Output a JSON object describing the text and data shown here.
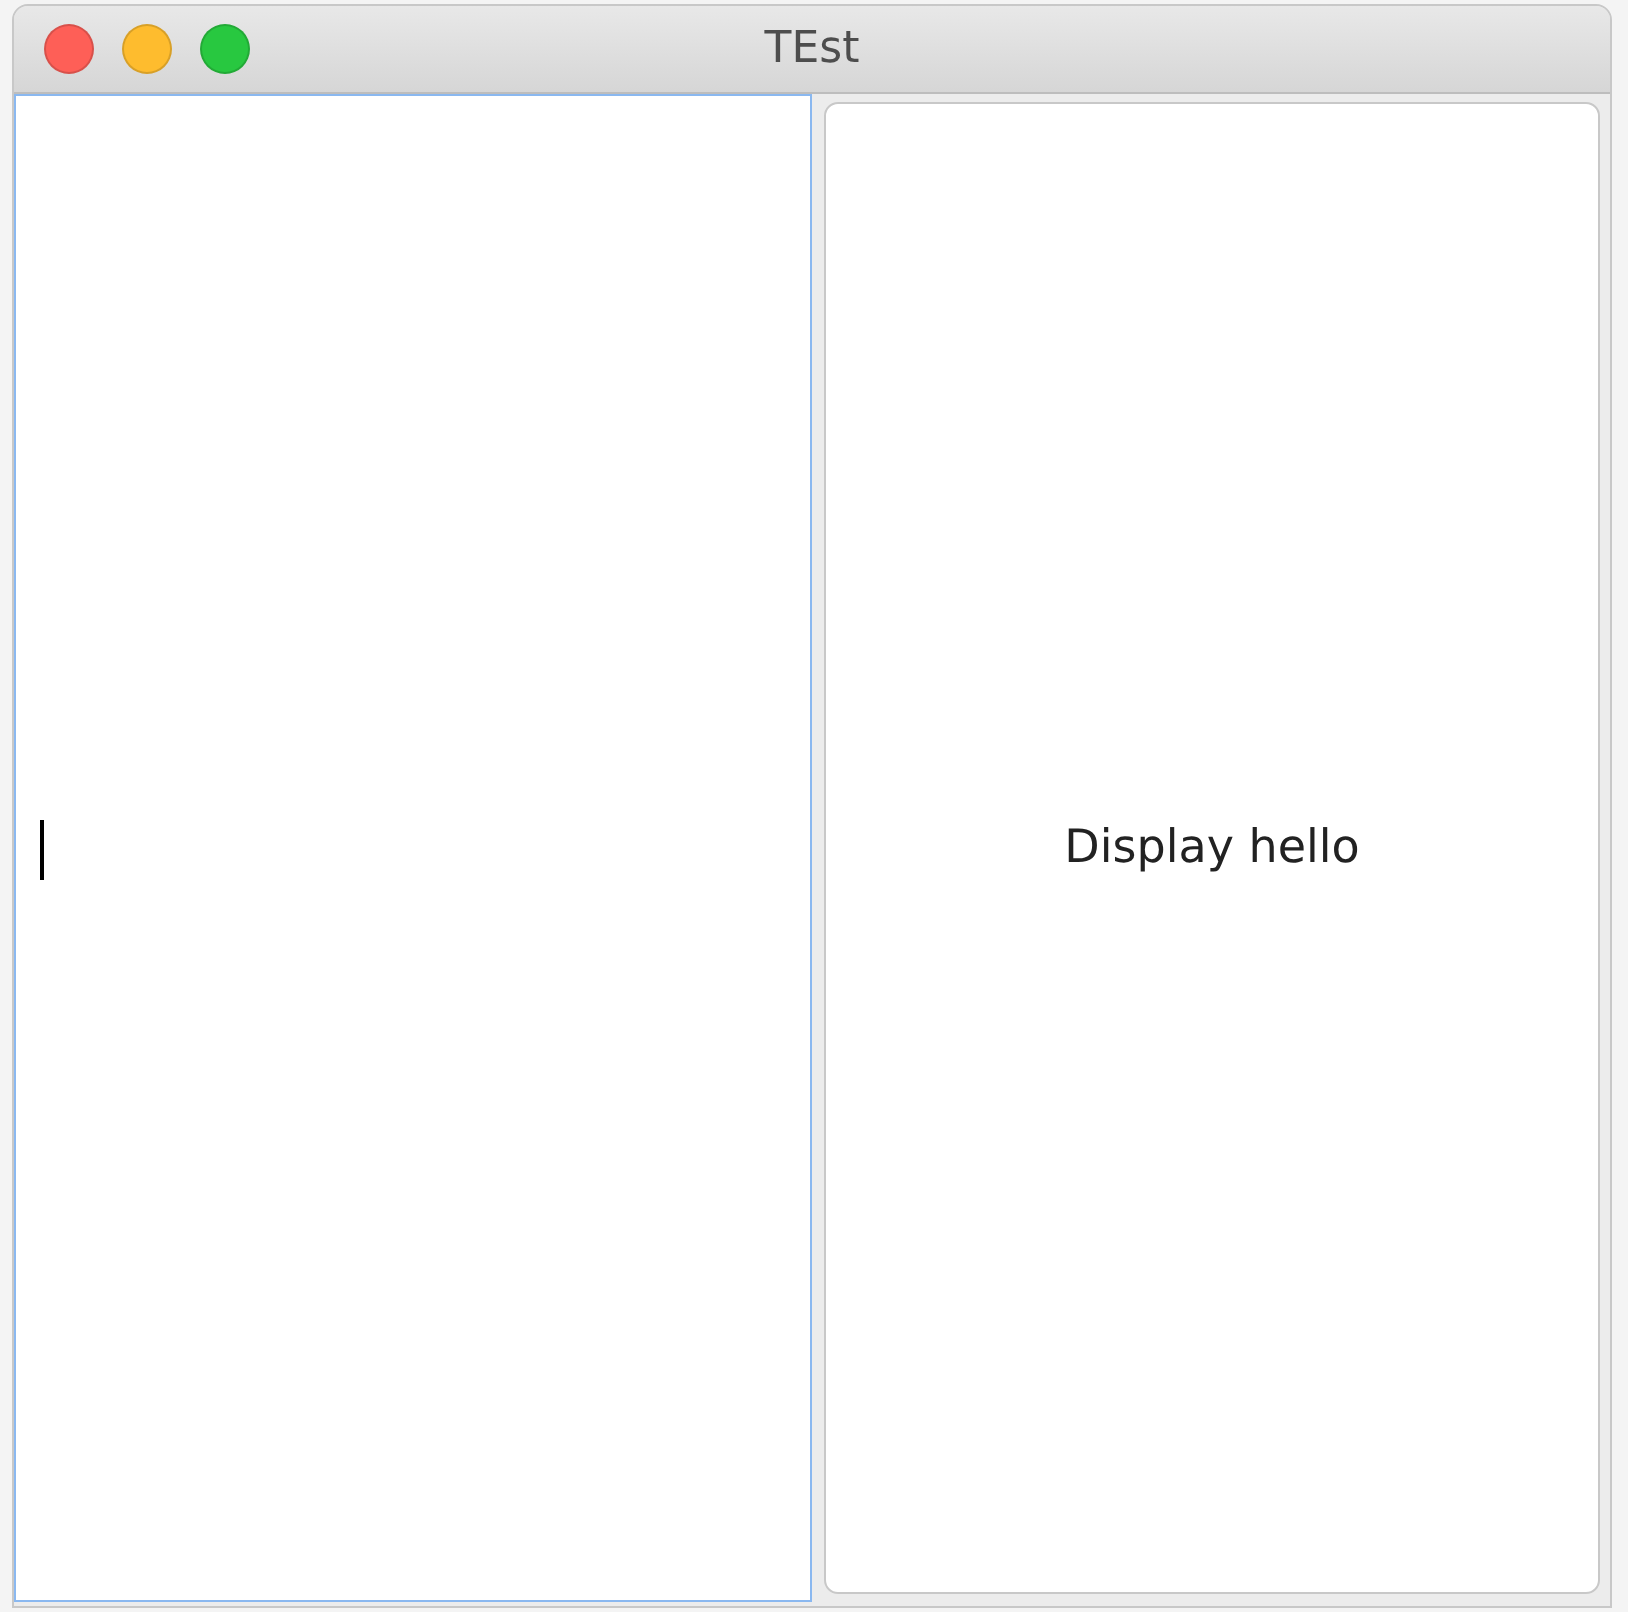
{
  "window": {
    "title": "TEst"
  },
  "text_field": {
    "focused": true
  },
  "button": {
    "label": "Display hello"
  }
}
